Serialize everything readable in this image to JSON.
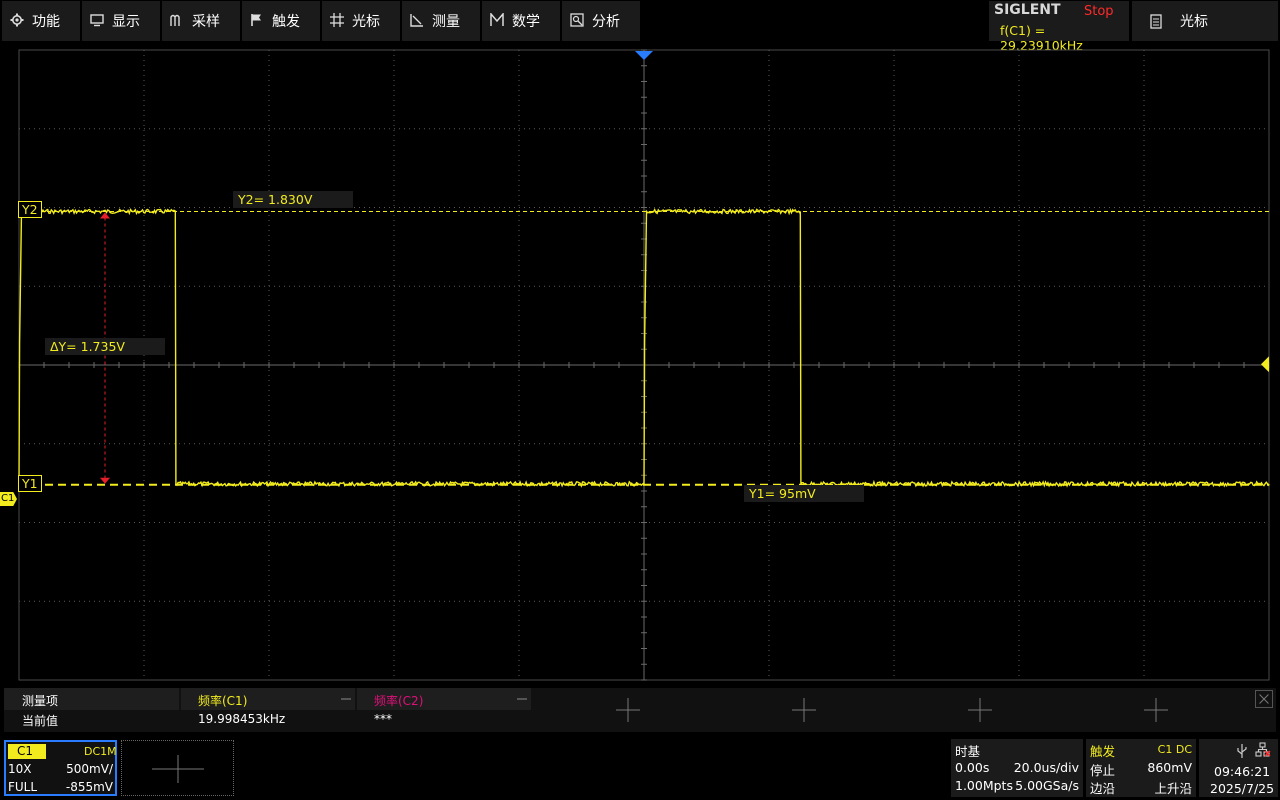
{
  "menu": [
    {
      "label": "功能",
      "icon": "gear-icon"
    },
    {
      "label": "显示",
      "icon": "monitor-icon"
    },
    {
      "label": "采样",
      "icon": "acquire-icon"
    },
    {
      "label": "触发",
      "icon": "flag-icon"
    },
    {
      "label": "光标",
      "icon": "cursor-cross-icon"
    },
    {
      "label": "测量",
      "icon": "measure-icon"
    },
    {
      "label": "数学",
      "icon": "math-icon"
    },
    {
      "label": "分析",
      "icon": "analysis-icon"
    }
  ],
  "brand": "SIGLENT",
  "run_state": "Stop",
  "freq_readout": "f(C1) = 29.23910kHz",
  "cursor_menu": {
    "label": "光标",
    "icon": "clipboard-icon"
  },
  "colors": {
    "trace": "#f2ec1e",
    "cursor_delta": "#e8202a",
    "run_state": "#ff2a2a",
    "channel2": "#e0107a",
    "accent": "#2a7cff",
    "grid": "#5a5a5a"
  },
  "cursors": {
    "y2_tag": "Y2",
    "y1_tag": "Y1",
    "y2_value": "Y2= 1.830V",
    "y1_value": "Y1= 95mV",
    "delta_value": "ΔY= 1.735V",
    "channel_marker": "C1"
  },
  "measurements": {
    "row_header": "测量项",
    "row_value_label": "当前值",
    "items": [
      {
        "name": "频率(C1)",
        "value": "19.998453kHz",
        "color": "#f2ec1e"
      },
      {
        "name": "频率(C2)",
        "value": "***",
        "color": "#e0107a"
      }
    ]
  },
  "channel1": {
    "badge": "C1",
    "coupling": "DC1M",
    "probe": "10X",
    "scale": "500mV/",
    "bandwidth": "FULL",
    "offset": "-855mV"
  },
  "timebase": {
    "title": "时基",
    "delay": "0.00s",
    "scale": "20.0us/div",
    "memory": "1.00Mpts",
    "sample_rate": "5.00GSa/s"
  },
  "trigger": {
    "title": "触发",
    "source": "C1 DC",
    "state": "停止",
    "level": "860mV",
    "type": "边沿",
    "slope": "上升沿"
  },
  "clock": {
    "time": "09:46:21",
    "date": "2025/7/25"
  },
  "chart_data": {
    "type": "line",
    "title": "",
    "xlabel": "",
    "ylabel": "",
    "x_divisions": 10,
    "y_divisions": 8,
    "time_per_div_us": 20,
    "volts_per_div": 0.5,
    "xlim_us": [
      -100,
      100
    ],
    "series": [
      {
        "x_us": [
          -100,
          -99.9,
          -99.6,
          -75.0,
          -74.9,
          0.0,
          0.1,
          0.4,
          25.0,
          25.1,
          100
        ],
        "y_V": [
          0.1,
          1.0,
          1.83,
          1.83,
          0.1,
          0.1,
          1.0,
          1.83,
          1.83,
          0.1,
          0.1
        ]
      }
    ],
    "cursor_y2_V": 1.83,
    "cursor_y1_V": 0.095,
    "trigger_level_V": 0.86,
    "grid": true
  }
}
